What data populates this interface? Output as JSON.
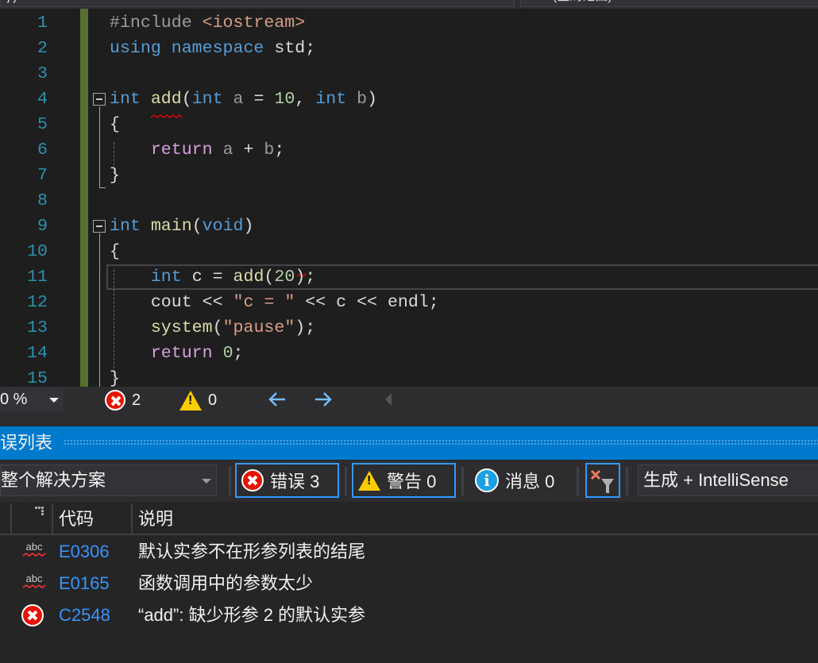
{
  "top": {
    "project_dropdown": "j j",
    "scope_dropdown": "(全局范围)"
  },
  "editor": {
    "line_numbers": [
      "1",
      "2",
      "3",
      "4",
      "5",
      "6",
      "7",
      "8",
      "9",
      "10",
      "11",
      "12",
      "13",
      "14",
      "15"
    ],
    "colors": {
      "keyword": "#569cd6",
      "preproc": "#9b9b9b",
      "string": "#d69d85",
      "func": "#dcdcaa",
      "param": "#9a9a9a",
      "number": "#b5cea8",
      "control": "#d8a0df",
      "plain": "#dadada"
    },
    "lines": [
      [
        [
          "#include ",
          "preproc"
        ],
        [
          "<iostream>",
          "string"
        ]
      ],
      [
        [
          "using ",
          "keyword"
        ],
        [
          "namespace ",
          "keyword"
        ],
        [
          "std;",
          "plain"
        ]
      ],
      [],
      [
        [
          "int ",
          "keyword"
        ],
        [
          "add",
          "func"
        ],
        [
          "(",
          "plain"
        ],
        [
          "int ",
          "keyword"
        ],
        [
          "a ",
          "param"
        ],
        [
          "= ",
          "plain"
        ],
        [
          "10",
          "number"
        ],
        [
          ", ",
          "plain"
        ],
        [
          "int ",
          "keyword"
        ],
        [
          "b",
          "param"
        ],
        [
          ")",
          "plain"
        ]
      ],
      [
        [
          "{",
          "plain"
        ]
      ],
      [
        [
          "    ",
          "plain"
        ],
        [
          "return ",
          "control"
        ],
        [
          "a ",
          "param"
        ],
        [
          "+ ",
          "plain"
        ],
        [
          "b",
          "param"
        ],
        [
          ";",
          "plain"
        ]
      ],
      [
        [
          "}",
          "plain"
        ]
      ],
      [],
      [
        [
          "int ",
          "keyword"
        ],
        [
          "main",
          "func"
        ],
        [
          "(",
          "plain"
        ],
        [
          "void",
          "keyword"
        ],
        [
          ")",
          "plain"
        ]
      ],
      [
        [
          "{",
          "plain"
        ]
      ],
      [
        [
          "    ",
          "plain"
        ],
        [
          "int ",
          "keyword"
        ],
        [
          "c ",
          "plain"
        ],
        [
          "= ",
          "plain"
        ],
        [
          "add",
          "func"
        ],
        [
          "(",
          "plain"
        ],
        [
          "20",
          "number"
        ],
        [
          ")",
          "plain"
        ],
        [
          ";",
          "plain"
        ]
      ],
      [
        [
          "    ",
          "plain"
        ],
        [
          "cout ",
          "plain"
        ],
        [
          "<< ",
          "plain"
        ],
        [
          "\"c = \"",
          "string"
        ],
        [
          " << ",
          "plain"
        ],
        [
          "c ",
          "plain"
        ],
        [
          "<< ",
          "plain"
        ],
        [
          "endl;",
          "plain"
        ]
      ],
      [
        [
          "    ",
          "plain"
        ],
        [
          "system",
          "func"
        ],
        [
          "(",
          "plain"
        ],
        [
          "\"pause\"",
          "string"
        ],
        [
          ");",
          "plain"
        ]
      ],
      [
        [
          "    ",
          "plain"
        ],
        [
          "return ",
          "control"
        ],
        [
          "0",
          "number"
        ],
        [
          ";",
          "plain"
        ]
      ],
      [
        [
          "}",
          "plain"
        ]
      ]
    ]
  },
  "status": {
    "zoom": "0 %",
    "errors": "2",
    "warnings": "0",
    "back_icon": "arrow-left-icon",
    "forward_icon": "arrow-right-icon"
  },
  "error_list": {
    "title": "误列表",
    "scope": "整个解决方案",
    "errors_btn": "错误 3",
    "warnings_btn": "警告 0",
    "messages_btn": "消息 0",
    "source": "生成 + IntelliSense",
    "columns": {
      "code": "代码",
      "description": "说明"
    },
    "rows": [
      {
        "icon": "intellisense-squiggle-icon",
        "code": "E0306",
        "description": "默认实参不在形参列表的结尾"
      },
      {
        "icon": "intellisense-squiggle-icon",
        "code": "E0165",
        "description": "函数调用中的参数太少"
      },
      {
        "icon": "error-icon",
        "code": "C2548",
        "description": "“add”: 缺少形参 2 的默认实参"
      }
    ],
    "abc_label": "abc"
  },
  "accent": "#007acc"
}
